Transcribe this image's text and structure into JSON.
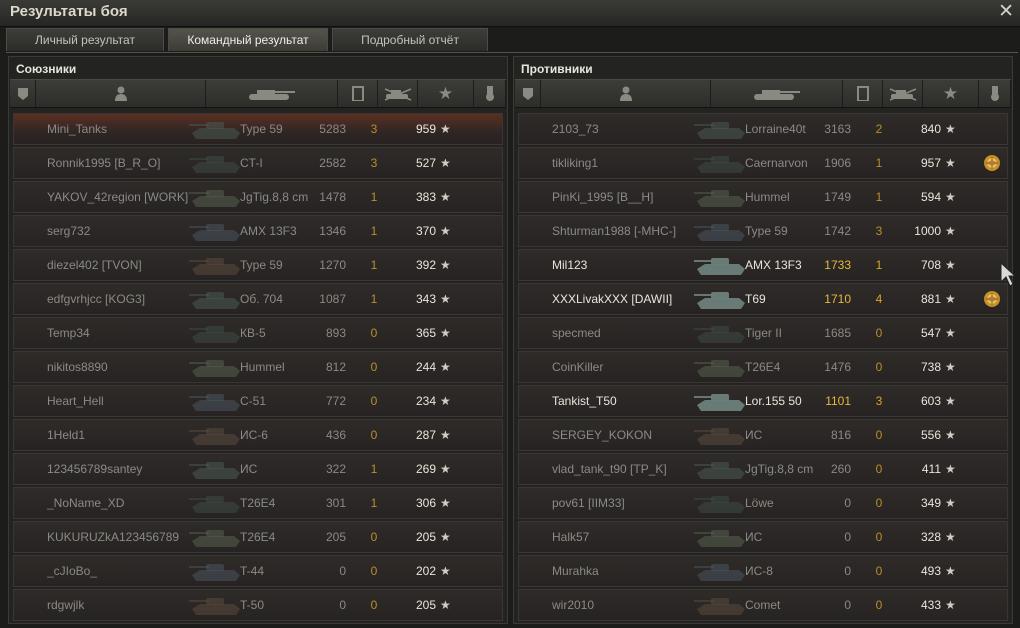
{
  "window": {
    "title": "Результаты боя"
  },
  "tabs": [
    {
      "label": "Личный результат"
    },
    {
      "label": "Командный результат"
    },
    {
      "label": "Подробный отчёт"
    }
  ],
  "allies": {
    "title": "Союзники",
    "rows": [
      {
        "name": "Mini_Tanks",
        "tank": "Type 59",
        "xp": "5283",
        "kills": "3",
        "points": "959"
      },
      {
        "name": "Ronnik1995 [B_R_O]",
        "tank": "CT-I",
        "xp": "2582",
        "kills": "3",
        "points": "527"
      },
      {
        "name": "YAKOV_42region [WORK]",
        "tank": "JgTig.8,8 cm",
        "xp": "1478",
        "kills": "1",
        "points": "383"
      },
      {
        "name": "serg732",
        "tank": "AMX 13F3",
        "xp": "1346",
        "kills": "1",
        "points": "370"
      },
      {
        "name": "diezel402 [TVON]",
        "tank": "Type 59",
        "xp": "1270",
        "kills": "1",
        "points": "392"
      },
      {
        "name": "edfgvrhjcc [KOG3]",
        "tank": "Об. 704",
        "xp": "1087",
        "kills": "1",
        "points": "343"
      },
      {
        "name": "Temp34",
        "tank": "КВ-5",
        "xp": "893",
        "kills": "0",
        "points": "365"
      },
      {
        "name": "nikitos8890",
        "tank": "Hummel",
        "xp": "812",
        "kills": "0",
        "points": "244"
      },
      {
        "name": "Heart_Hell",
        "tank": "С-51",
        "xp": "772",
        "kills": "0",
        "points": "234"
      },
      {
        "name": "1Held1",
        "tank": "ИС-6",
        "xp": "436",
        "kills": "0",
        "points": "287"
      },
      {
        "name": "123456789santey",
        "tank": "ИС",
        "xp": "322",
        "kills": "1",
        "points": "269"
      },
      {
        "name": "_NoName_XD",
        "tank": "T26E4",
        "xp": "301",
        "kills": "1",
        "points": "306"
      },
      {
        "name": "KUKURUZkA123456789",
        "tank": "T26E4",
        "xp": "205",
        "kills": "0",
        "points": "205"
      },
      {
        "name": "_cJIoBo_",
        "tank": "T-44",
        "xp": "0",
        "kills": "0",
        "points": "202"
      },
      {
        "name": "rdgwjlk",
        "tank": "T-50",
        "xp": "0",
        "kills": "0",
        "points": "205"
      }
    ]
  },
  "enemies": {
    "title": "Противники",
    "rows": [
      {
        "name": "2103_73",
        "tank": "Lorraine40t",
        "xp": "3163",
        "kills": "2",
        "points": "840"
      },
      {
        "name": "tikliking1",
        "tank": "Caernarvon",
        "xp": "1906",
        "kills": "1",
        "points": "957",
        "medal": true
      },
      {
        "name": "PinKi_1995 [B__H]",
        "tank": "Hummel",
        "xp": "1749",
        "kills": "1",
        "points": "594"
      },
      {
        "name": "Shturman1988 [-MHC-]",
        "tank": "Type 59",
        "xp": "1742",
        "kills": "3",
        "points": "1000"
      },
      {
        "name": "Mil123",
        "tank": "AMX 13F3",
        "xp": "1733",
        "kills": "1",
        "points": "708"
      },
      {
        "name": "XXXLivakXXX [DAWII]",
        "tank": "T69",
        "xp": "1710",
        "kills": "4",
        "points": "881",
        "medal": true
      },
      {
        "name": "specmed",
        "tank": "Tiger II",
        "xp": "1685",
        "kills": "0",
        "points": "547"
      },
      {
        "name": "CoinKiller",
        "tank": "T26E4",
        "xp": "1476",
        "kills": "0",
        "points": "738"
      },
      {
        "name": "Tankist_T50",
        "tank": "Lor.155 50",
        "xp": "1101",
        "kills": "3",
        "points": "603"
      },
      {
        "name": "SERGEY_KOKON",
        "tank": "ИС",
        "xp": "816",
        "kills": "0",
        "points": "556"
      },
      {
        "name": "vlad_tank_t90 [TP_K]",
        "tank": "JgTig.8,8 cm",
        "xp": "260",
        "kills": "0",
        "points": "411"
      },
      {
        "name": "pov61 [IIM33]",
        "tank": "Löwe",
        "xp": "0",
        "kills": "0",
        "points": "349"
      },
      {
        "name": "Halk57",
        "tank": "ИС",
        "xp": "0",
        "kills": "0",
        "points": "328"
      },
      {
        "name": "Murahka",
        "tank": "ИС-8",
        "xp": "0",
        "kills": "0",
        "points": "493"
      },
      {
        "name": "wir2010",
        "tank": "Comet",
        "xp": "0",
        "kills": "0",
        "points": "433"
      }
    ]
  },
  "icons": {
    "close": "close-icon",
    "column_headers": [
      "squad-icon",
      "player-icon",
      "tank-icon",
      "damage-icon",
      "kills-icon",
      "points-icon",
      "medal-icon"
    ],
    "points_star": "★",
    "medal": "medal-icon"
  }
}
